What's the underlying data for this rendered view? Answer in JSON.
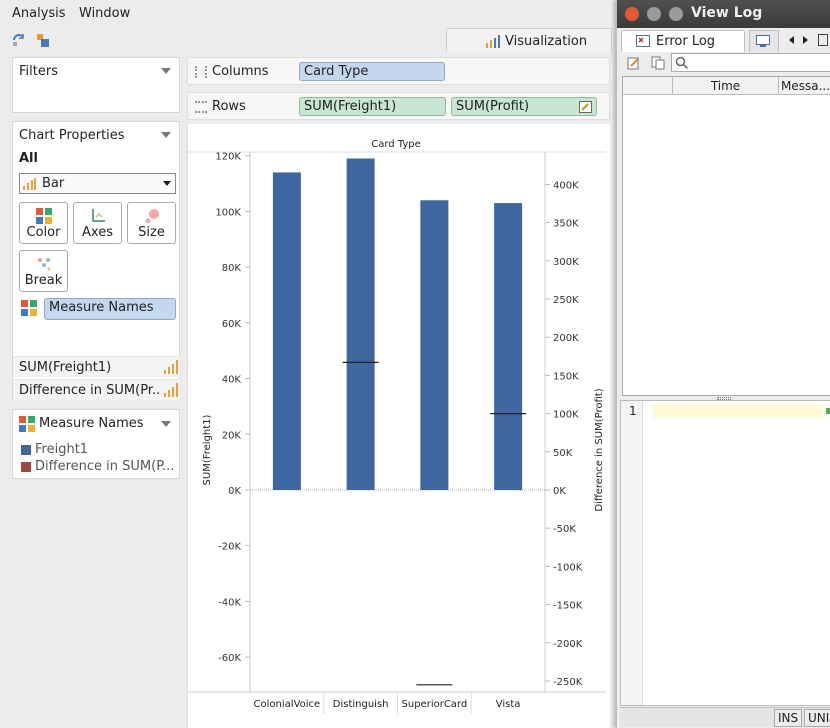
{
  "menu": {
    "analysis": "Analysis",
    "window": "Window"
  },
  "viz_tab": {
    "label": "Visualization"
  },
  "filters": {
    "title": "Filters"
  },
  "shelves": {
    "columns": {
      "label": "Columns",
      "pills": [
        "Card Type"
      ]
    },
    "rows": {
      "label": "Rows",
      "pills": [
        "SUM(Freight1)",
        "SUM(Profit)"
      ]
    }
  },
  "chart_props": {
    "title": "Chart Properties",
    "selector": "All",
    "chart_type": "Bar",
    "buttons": {
      "color": "Color",
      "axes": "Axes",
      "size": "Size",
      "break": "Break"
    },
    "color_field": "Measure Names",
    "measures": [
      "SUM(Freight1)",
      "Difference in SUM(Pr..."
    ]
  },
  "legend": {
    "title": "Measure Names",
    "items": [
      {
        "label": "Freight1",
        "color": "#3e66a0"
      },
      {
        "label": "Difference in SUM(P...",
        "color": "#a0473f"
      }
    ]
  },
  "chart_data": {
    "type": "bar",
    "title": "Card Type",
    "categories": [
      "ColonialVoice",
      "Distinguish",
      "SuperiorCard",
      "Vista"
    ],
    "series": [
      {
        "name": "Freight1",
        "axis": "left",
        "mark": "bar",
        "color": "#3e66a0",
        "values": [
          114000,
          119000,
          104000,
          103000
        ]
      },
      {
        "name": "Difference in SUM(Profit)",
        "axis": "right",
        "mark": "tick",
        "color": "#222222",
        "values": [
          null,
          167000,
          -255000,
          100000
        ]
      }
    ],
    "ylabel_left": "SUM(Freight1)",
    "ylabel_right": "Difference in SUM(Profit)",
    "ylim_left": [
      -73000,
      122000
    ],
    "ylim_right": [
      -270000,
      440000
    ],
    "yticks_left": [
      "120K",
      "100K",
      "80K",
      "60K",
      "40K",
      "20K",
      "0K",
      "-20K",
      "-40K",
      "-60K"
    ],
    "yticks_right": [
      "400K",
      "350K",
      "300K",
      "250K",
      "200K",
      "150K",
      "100K",
      "50K",
      "0K",
      "-50K",
      "-100K",
      "-150K",
      "-200K",
      "-250K"
    ]
  },
  "viewlog": {
    "title": "View Log",
    "tab_error": "Error Log",
    "columns": [
      "Time",
      "Messa..."
    ],
    "line_number": "1",
    "status": [
      "INS",
      "UNI"
    ]
  }
}
